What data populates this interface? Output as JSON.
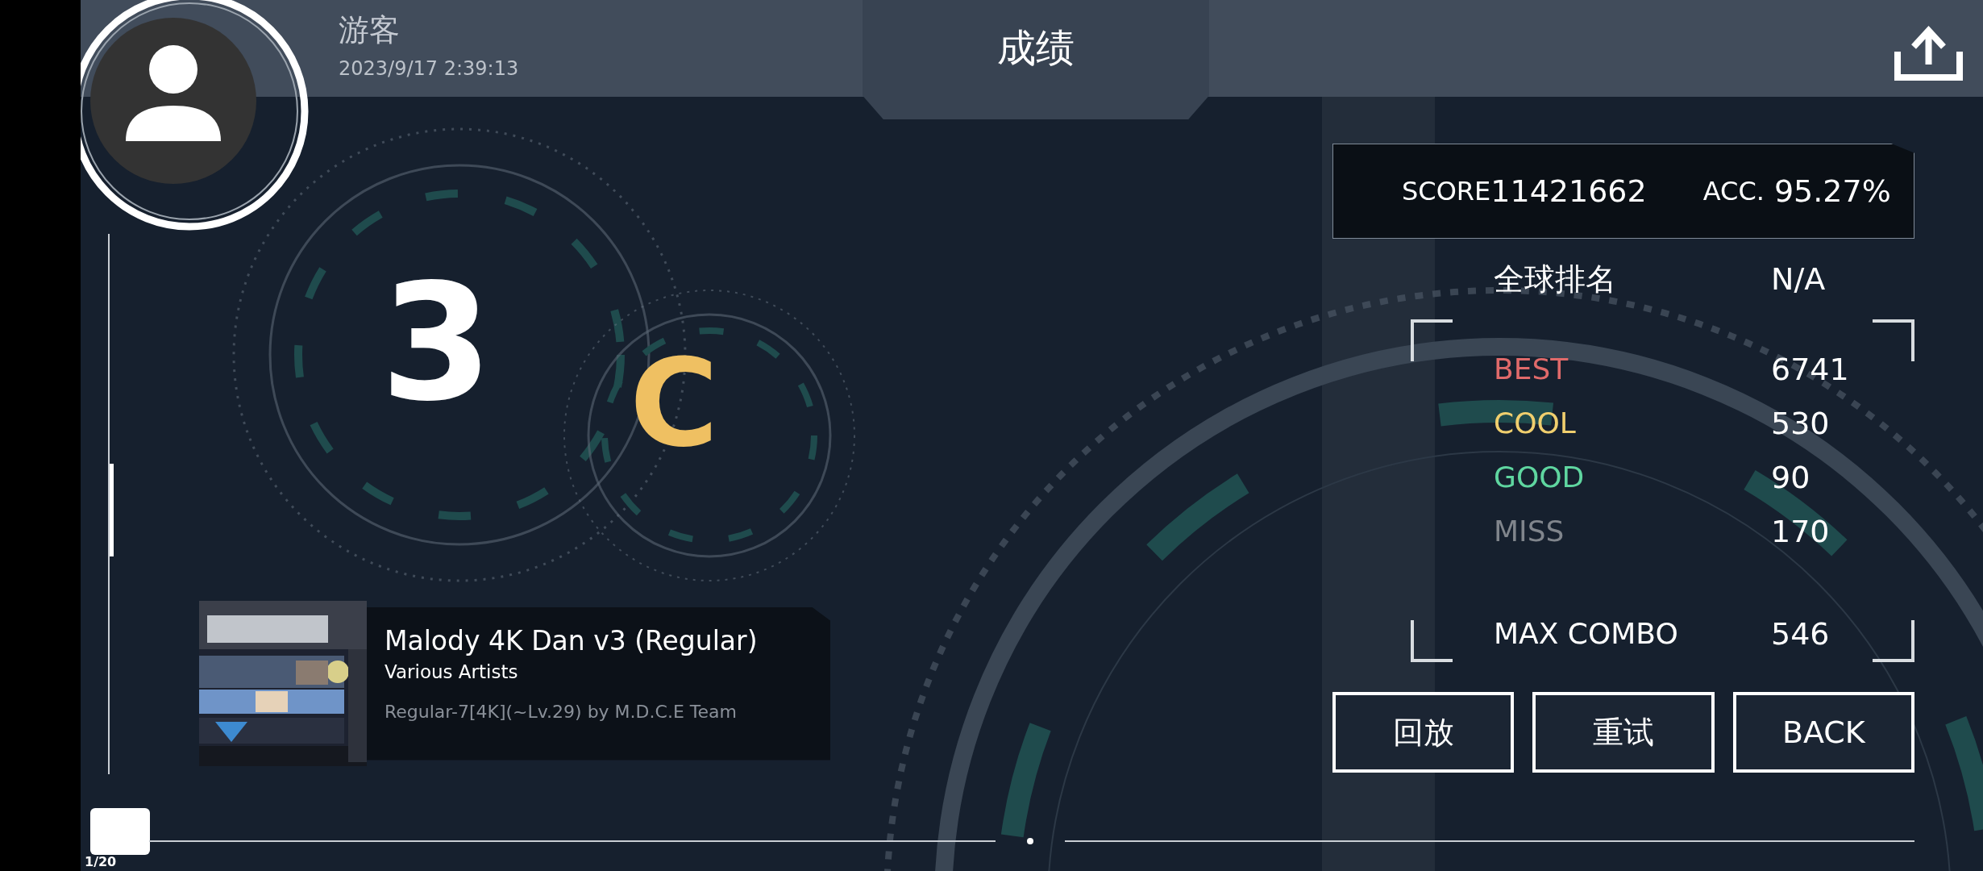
{
  "header": {
    "user_name": "游客",
    "timestamp": "2023/9/17 2:39:13",
    "title": "成绩"
  },
  "grade": {
    "rank": "3",
    "letter": "C"
  },
  "song": {
    "title": "Malody 4K Dan v3 (Regular)",
    "artist": "Various Artists",
    "chart": "Regular-7[4K](~Lv.29) by M.D.C.E Team"
  },
  "summary": {
    "score_label": "SCORE",
    "score": "11421662",
    "acc_label": "ACC.",
    "acc": "95.27%"
  },
  "ranking": {
    "label": "全球排名",
    "value": "N/A"
  },
  "judgments": [
    {
      "label": "BEST",
      "value": "6741",
      "color": "#e06a6a"
    },
    {
      "label": "COOL",
      "value": "530",
      "color": "#f0cf6e"
    },
    {
      "label": "GOOD",
      "value": "90",
      "color": "#5fd6a0"
    },
    {
      "label": "MISS",
      "value": "170",
      "color": "#80858c"
    }
  ],
  "max_combo": {
    "label": "MAX COMBO",
    "value": "546"
  },
  "buttons": [
    "回放",
    "重试",
    "BACK"
  ],
  "page_indicator": "1/20"
}
